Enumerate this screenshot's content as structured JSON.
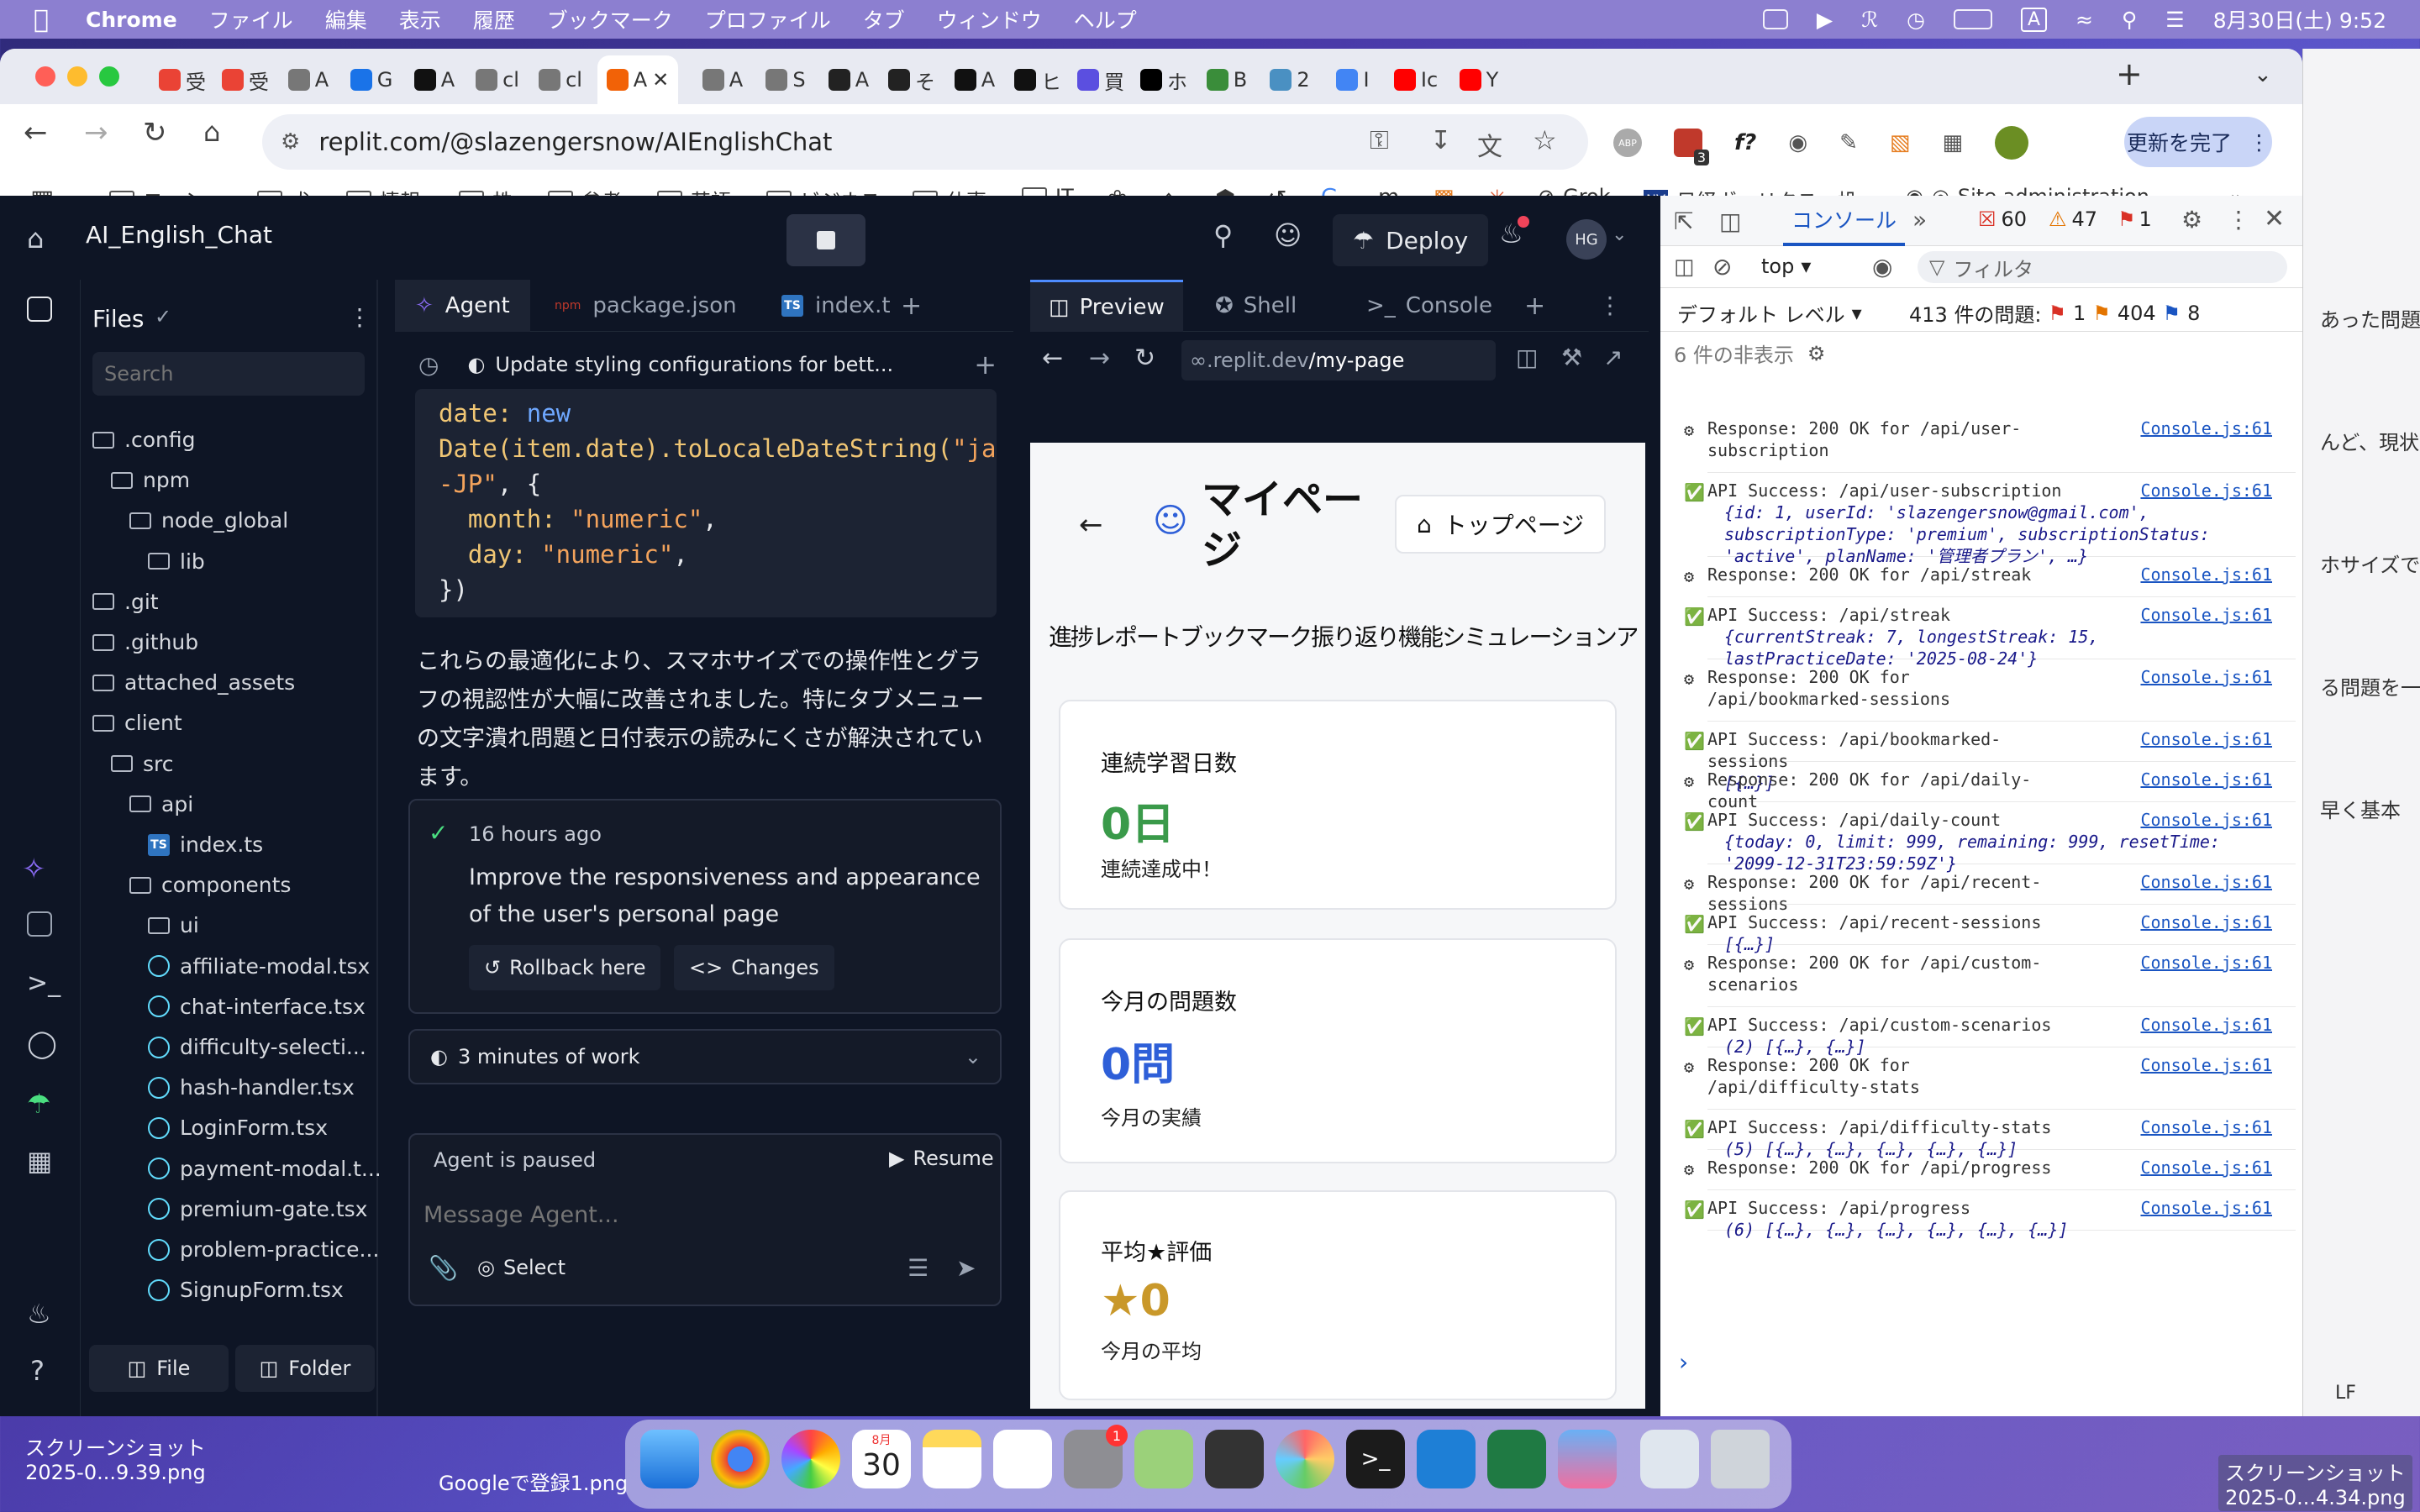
{
  "menubar": {
    "app": "Chrome",
    "items": [
      "ファイル",
      "編集",
      "表示",
      "履歴",
      "ブックマーク",
      "プロファイル",
      "タブ",
      "ウィンドウ",
      "ヘルプ"
    ],
    "clock": "8月30日(土) 9:52",
    "input_indicator": "A"
  },
  "chrome": {
    "tabs": [
      {
        "label": "受",
        "icon": "gmail-icon",
        "color": "#ea4335"
      },
      {
        "label": "受",
        "icon": "gmail-icon",
        "color": "#ea4335"
      },
      {
        "label": "A",
        "icon": "globe-icon",
        "color": "#777777"
      },
      {
        "label": "G",
        "icon": "calendar-icon",
        "color": "#1a73e8"
      },
      {
        "label": "A",
        "icon": "dark-app-icon",
        "color": "#111111"
      },
      {
        "label": "cl",
        "icon": "globe-icon",
        "color": "#777777"
      },
      {
        "label": "cl",
        "icon": "globe-icon",
        "color": "#777777"
      },
      {
        "label": "A",
        "icon": "replit-icon",
        "color": "#f26207",
        "active": true
      },
      {
        "label": "A",
        "icon": "globe-icon",
        "color": "#777777"
      },
      {
        "label": "S",
        "icon": "camera-icon",
        "color": "#777777"
      },
      {
        "label": "A",
        "icon": "openai-icon",
        "color": "#222222"
      },
      {
        "label": "そ",
        "icon": "openai-icon",
        "color": "#222222"
      },
      {
        "label": "A",
        "icon": "notion-icon",
        "color": "#111111"
      },
      {
        "label": "ヒ",
        "icon": "notion-icon",
        "color": "#111111"
      },
      {
        "label": "買",
        "icon": "s-icon",
        "color": "#5b4fe0"
      },
      {
        "label": "ホ",
        "icon": "x-icon",
        "color": "#000000"
      },
      {
        "label": "B",
        "icon": "chart-icon",
        "color": "#3a8d3a"
      },
      {
        "label": "2",
        "icon": "clock-icon",
        "color": "#4a90c2"
      },
      {
        "label": "I",
        "icon": "google-icon",
        "color": "#4285f4"
      },
      {
        "label": "Ic",
        "icon": "youtube-icon",
        "color": "#ff0000"
      },
      {
        "label": "Y",
        "icon": "youtube-icon",
        "color": "#ff0000"
      }
    ],
    "url": "replit.com/@slazengersnow/AIEnglishChat",
    "update_label": "更新を完了",
    "ext_badge": "3",
    "bookmarks": [
      "ヨッシー",
      "犬",
      "情報",
      "株",
      "参考",
      "英語",
      "ビジネス",
      "仕事",
      "IT"
    ],
    "bookmarks_more": [
      "Grok",
      "日経ヴェリタス - 投...",
      "Site administration..."
    ]
  },
  "replit": {
    "project": "AI_English_Chat",
    "deploy_label": "Deploy",
    "avatar": "HG",
    "files_title": "Files",
    "search_placeholder": "Search",
    "tree": [
      {
        "name": ".config",
        "type": "folder",
        "depth": 0
      },
      {
        "name": "npm",
        "type": "folder",
        "depth": 1
      },
      {
        "name": "node_global",
        "type": "folder",
        "depth": 2
      },
      {
        "name": "lib",
        "type": "folder",
        "depth": 3
      },
      {
        "name": ".git",
        "type": "folder",
        "depth": 0
      },
      {
        "name": ".github",
        "type": "folder",
        "depth": 0
      },
      {
        "name": "attached_assets",
        "type": "folder",
        "depth": 0
      },
      {
        "name": "client",
        "type": "folder",
        "depth": 0
      },
      {
        "name": "src",
        "type": "folder",
        "depth": 1
      },
      {
        "name": "api",
        "type": "folder",
        "depth": 2
      },
      {
        "name": "index.ts",
        "type": "ts",
        "depth": 3
      },
      {
        "name": "components",
        "type": "folder",
        "depth": 2
      },
      {
        "name": "ui",
        "type": "folder",
        "depth": 3
      },
      {
        "name": "affiliate-modal.tsx",
        "type": "tsx",
        "depth": 3
      },
      {
        "name": "chat-interface.tsx",
        "type": "tsx",
        "depth": 3
      },
      {
        "name": "difficulty-selecti...",
        "type": "tsx",
        "depth": 3
      },
      {
        "name": "hash-handler.tsx",
        "type": "tsx",
        "depth": 3
      },
      {
        "name": "LoginForm.tsx",
        "type": "tsx",
        "depth": 3
      },
      {
        "name": "payment-modal.t...",
        "type": "tsx",
        "depth": 3
      },
      {
        "name": "premium-gate.tsx",
        "type": "tsx",
        "depth": 3
      },
      {
        "name": "problem-practice...",
        "type": "tsx",
        "depth": 3
      },
      {
        "name": "SignupForm.tsx",
        "type": "tsx",
        "depth": 3
      }
    ],
    "file_btn": "File",
    "folder_btn": "Folder",
    "editor_tabs": [
      "Agent",
      "package.json",
      "index.t"
    ],
    "agent_header": "Update styling configurations for bett...",
    "code": {
      "l1_key": "date: ",
      "l1_kw": "new",
      "l2_fn": "Date(item.date).toLocaleDateString(",
      "l2_str": "\"ja",
      "l3_str": "-JP\"",
      "l3_rest": ", {",
      "l4_key": "  month: ",
      "l4_str": "\"numeric\"",
      "l5_key": "  day: ",
      "l5_str": "\"numeric\"",
      "comma": ",",
      "l6": "})"
    },
    "agent_message": "これらの最適化により、スマホサイズでの操作性とグラフの視認性が大幅に改善されました。特にタブメニューの文字潰れ問題と日付表示の読みにくさが解決されています。",
    "checkpoint_time": "16 hours ago",
    "checkpoint_text": "Improve the responsiveness and appearance of the user's personal page",
    "rollback_label": "Rollback here",
    "changes_label": "Changes",
    "work_time": "3 minutes of work",
    "paused_label": "Agent is paused",
    "resume_label": "Resume",
    "message_placeholder": "Message Agent...",
    "select_label": "Select",
    "preview_tabs": [
      "Preview",
      "Shell",
      "Console"
    ],
    "preview_url_host": ".replit.dev",
    "preview_url_path": "/my-page"
  },
  "mypage": {
    "title": "マイページ",
    "top_btn": "トップページ",
    "tabs_overlapped": "進捗レポートブックマーク振り返り機能シミュレーションアカウント",
    "tab_list": [
      "進捗レポート",
      "ブックマーク",
      "振り返り機能",
      "シミュレーション",
      "アカウント"
    ],
    "cards": [
      {
        "title": "連続学習日数",
        "value": "0日",
        "sub": "連続達成中！",
        "color": "#3a9a4a"
      },
      {
        "title": "今月の問題数",
        "value": "0問",
        "sub": "今月の実績",
        "color": "#2e5fd8"
      },
      {
        "title": "平均★評価",
        "value": "★0",
        "sub": "今月の平均",
        "color": "#c9982a"
      }
    ]
  },
  "devtools": {
    "tab_active": "コンソール",
    "errors": "60",
    "warnings": "47",
    "issues_badge": "1",
    "context": "top",
    "filter_placeholder": "フィルタ",
    "level": "デフォルト レベル",
    "issues_text": "413 件の問題:",
    "issue_err": "1",
    "issue_warn": "404",
    "issue_info": "8",
    "hidden": "6 件の非表示",
    "link": "Console.js:61",
    "logs": [
      {
        "kind": "resp",
        "text": "Response: 200 OK for /api/user-subscription",
        "lines": 2
      },
      {
        "kind": "ok",
        "text": "API Success: /api/user-subscription",
        "detail": "{id: 1, userId: 'slazengersnow@gmail.com', subscriptionType: 'premium', subscriptionStatus: 'active', planName: '管理者プラン', …}",
        "lines": 3
      },
      {
        "kind": "resp",
        "text": "Response: 200 OK for /api/streak",
        "lines": 1
      },
      {
        "kind": "ok",
        "text": "API Success: /api/streak",
        "detail": "{currentStreak: 7, longestStreak: 15, lastPracticeDate: '2025-08-24'}",
        "lines": 2
      },
      {
        "kind": "resp",
        "text": "Response: 200 OK for /api/bookmarked-sessions",
        "lines": 2
      },
      {
        "kind": "ok",
        "text": "API Success: /api/bookmarked-sessions",
        "detail": "[{…}]",
        "lines": 1
      },
      {
        "kind": "resp",
        "text": "Response: 200 OK for /api/daily-count",
        "lines": 1
      },
      {
        "kind": "ok",
        "text": "API Success: /api/daily-count",
        "detail": "{today: 0, limit: 999, remaining: 999, resetTime: '2099-12-31T23:59:59Z'}",
        "lines": 2
      },
      {
        "kind": "resp",
        "text": "Response: 200 OK for /api/recent-sessions",
        "lines": 1
      },
      {
        "kind": "ok",
        "text": "API Success: /api/recent-sessions",
        "detail": "[{…}]",
        "lines": 1
      },
      {
        "kind": "resp",
        "text": "Response: 200 OK for /api/custom-scenarios",
        "lines": 2
      },
      {
        "kind": "ok",
        "text": "API Success: /api/custom-scenarios",
        "detail": "(2) [{…}, {…}]",
        "lines": 1
      },
      {
        "kind": "resp",
        "text": "Response: 200 OK for /api/difficulty-stats",
        "lines": 2
      },
      {
        "kind": "ok",
        "text": "API Success: /api/difficulty-stats",
        "detail": "(5) [{…}, {…}, {…}, {…}, {…}]",
        "lines": 1
      },
      {
        "kind": "resp",
        "text": "Response: 200 OK for /api/progress",
        "lines": 1
      },
      {
        "kind": "ok",
        "text": "API Success: /api/progress",
        "detail": "(6) [{…}, {…}, {…}, {…}, {…}, {…}]",
        "lines": 1
      }
    ]
  },
  "desktop": {
    "left_label_1": "スクリーンショット",
    "left_label_2": "2025-0...9.39.png",
    "google_label": "Googleで登録1.png",
    "right_label_1": "スクリーンショット",
    "right_label_2": "2025-0...4.34.png",
    "calendar_month": "8月",
    "calendar_day": "30",
    "settings_badge": "1",
    "behind_text": [
      "あった問題",
      "んど、現状",
      "ホサイズで",
      "る問題を一",
      "早く基本"
    ],
    "lf_label": "LF"
  }
}
